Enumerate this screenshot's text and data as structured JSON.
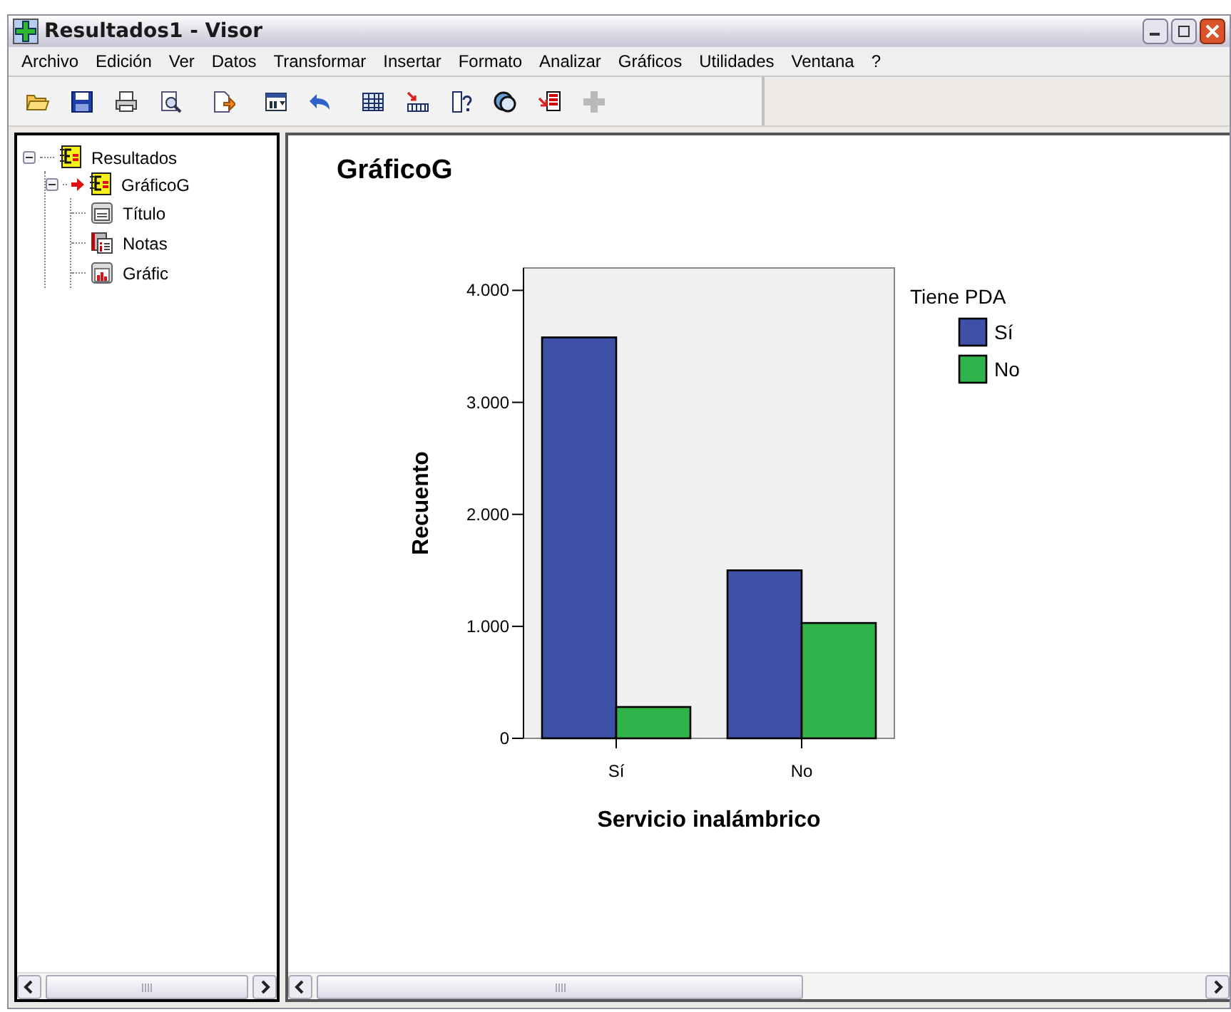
{
  "window": {
    "title": "Resultados1 - Visor"
  },
  "menu": [
    {
      "label": "Archivo"
    },
    {
      "label": "Edición"
    },
    {
      "label": "Ver"
    },
    {
      "label": "Datos"
    },
    {
      "label": "Transformar"
    },
    {
      "label": "Insertar"
    },
    {
      "label": "Formato"
    },
    {
      "label": "Analizar"
    },
    {
      "label": "Gráficos"
    },
    {
      "label": "Utilidades"
    },
    {
      "label": "Ventana"
    },
    {
      "label": "?"
    }
  ],
  "toolbar": [
    {
      "kind": "open",
      "disabled": false
    },
    {
      "kind": "save",
      "disabled": false
    },
    {
      "kind": "print",
      "disabled": false
    },
    {
      "kind": "preview",
      "disabled": false
    },
    {
      "kind": "export",
      "disabled": false
    },
    {
      "kind": "dialog",
      "disabled": false
    },
    {
      "kind": "undo",
      "disabled": false
    },
    {
      "kind": "table",
      "disabled": false
    },
    {
      "kind": "axis",
      "disabled": false
    },
    {
      "kind": "help",
      "disabled": false
    },
    {
      "kind": "circles",
      "disabled": false
    },
    {
      "kind": "list",
      "disabled": false
    },
    {
      "kind": "plus",
      "disabled": true
    }
  ],
  "outline": [
    {
      "label": "Resultados",
      "kind": "book",
      "expanded": true,
      "current": false,
      "children": [
        {
          "label": "GráficoG",
          "kind": "book",
          "expanded": true,
          "current": true,
          "children": [
            {
              "label": "Título",
              "kind": "title"
            },
            {
              "label": "Notas",
              "kind": "notes"
            },
            {
              "label": "Gráfic",
              "kind": "chart"
            }
          ]
        }
      ]
    }
  ],
  "output": {
    "heading": "GráficoG",
    "chart_data": {
      "type": "bar",
      "xlabel": "Servicio inalámbrico",
      "ylabel": "Recuento",
      "categories": [
        "Sí",
        "No"
      ],
      "legend": {
        "title": "Tiene PDA"
      },
      "series": [
        {
          "name": "Sí",
          "color": "#3f51a7",
          "values": [
            3580,
            1500
          ]
        },
        {
          "name": "No",
          "color": "#2fb34a",
          "values": [
            280,
            1030
          ]
        }
      ],
      "ylim": [
        0,
        4200
      ],
      "yticks": [
        {
          "value": 0,
          "label": "0"
        },
        {
          "value": 1000,
          "label": "1.000"
        },
        {
          "value": 2000,
          "label": "2.000"
        },
        {
          "value": 3000,
          "label": "3.000"
        },
        {
          "value": 4000,
          "label": "4.000"
        }
      ]
    }
  }
}
